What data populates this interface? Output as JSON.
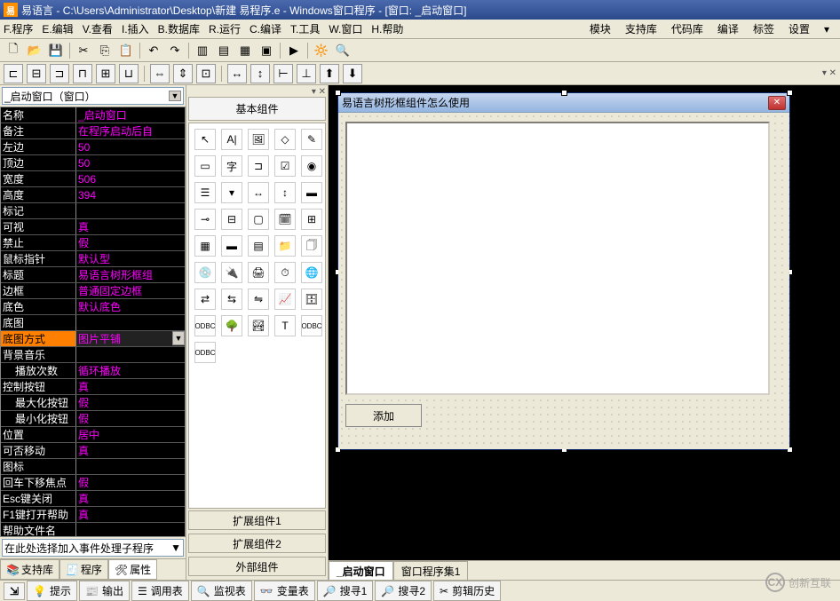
{
  "titlebar": {
    "app_name": "易语言",
    "path": "C:\\Users\\Administrator\\Desktop\\新建 易程序.e",
    "suffix": "Windows窗口程序 - [窗口: _启动窗口]"
  },
  "menu": {
    "items": [
      "F.程序",
      "E.编辑",
      "V.查看",
      "I.插入",
      "B.数据库",
      "R.运行",
      "C.编译",
      "T.工具",
      "W.窗口",
      "H.帮助"
    ],
    "right": [
      "模块",
      "支持库",
      "代码库",
      "编译",
      "标签",
      "设置"
    ]
  },
  "left": {
    "combo": "_启动窗口（窗口）",
    "event_combo": "在此处选择加入事件处理子程序",
    "tabs": [
      "支持库",
      "程序",
      "属性"
    ],
    "props": [
      {
        "name": "名称",
        "val": "_启动窗口"
      },
      {
        "name": "备注",
        "val": "在程序启动后自"
      },
      {
        "name": "左边",
        "val": "50"
      },
      {
        "name": "顶边",
        "val": "50"
      },
      {
        "name": "宽度",
        "val": "506"
      },
      {
        "name": "高度",
        "val": "394"
      },
      {
        "name": "标记",
        "val": ""
      },
      {
        "name": "可视",
        "val": "真"
      },
      {
        "name": "禁止",
        "val": "假"
      },
      {
        "name": "鼠标指针",
        "val": "默认型"
      },
      {
        "name": "标题",
        "val": "易语言树形框组"
      },
      {
        "name": "边框",
        "val": "普通固定边框"
      },
      {
        "name": "底色",
        "val": "默认底色"
      },
      {
        "name": "底图",
        "val": ""
      },
      {
        "name": "底图方式",
        "val": "图片平铺",
        "selected": true
      },
      {
        "name": "背景音乐",
        "val": ""
      },
      {
        "name": "播放次数",
        "val": "循环播放",
        "indent": true
      },
      {
        "name": "控制按钮",
        "val": "真"
      },
      {
        "name": "最大化按钮",
        "val": "假",
        "indent": true
      },
      {
        "name": "最小化按钮",
        "val": "假",
        "indent": true
      },
      {
        "name": "位置",
        "val": "居中"
      },
      {
        "name": "可否移动",
        "val": "真"
      },
      {
        "name": "图标",
        "val": ""
      },
      {
        "name": "回车下移焦点",
        "val": "假"
      },
      {
        "name": "Esc键关闭",
        "val": "真"
      },
      {
        "name": "F1键打开帮助",
        "val": "真"
      },
      {
        "name": "帮助文件名",
        "val": ""
      }
    ]
  },
  "mid": {
    "title": "基本组件",
    "buttons": [
      "扩展组件1",
      "扩展组件2",
      "外部组件"
    ]
  },
  "design": {
    "title": "易语言树形框组件怎么使用",
    "add_btn": "添加"
  },
  "canvas_tabs": [
    "_启动窗口",
    "窗口程序集1"
  ],
  "bottom_tabs": [
    "提示",
    "输出",
    "调用表",
    "监视表",
    "变量表",
    "搜寻1",
    "搜寻2",
    "剪辑历史"
  ],
  "watermark": "创新互联"
}
